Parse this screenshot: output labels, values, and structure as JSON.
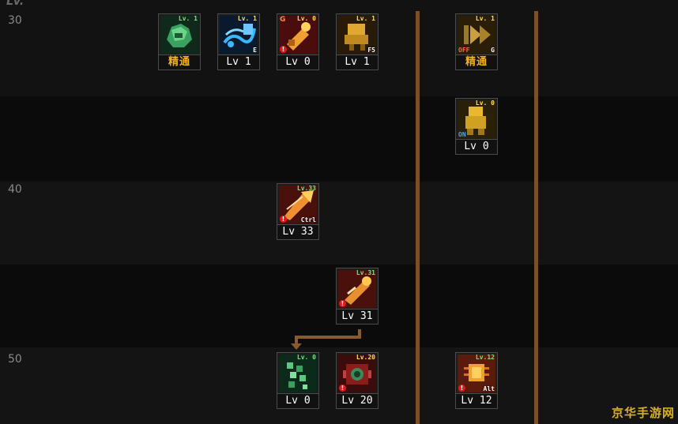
{
  "header": {
    "lv_header": "Lv."
  },
  "rows": [
    {
      "label": "30"
    },
    {
      "label": "40"
    },
    {
      "label": "50"
    }
  ],
  "skills": [
    {
      "id": "s1",
      "level_text": "精通",
      "icon": "green-glove-icon",
      "corner_lv": "Lv. 1",
      "key": "",
      "mastery": true
    },
    {
      "id": "s2",
      "level_text": "Lv 1",
      "icon": "blue-wind-icon",
      "corner_lv": "Lv. 1",
      "key": "E"
    },
    {
      "id": "s3",
      "level_text": "Lv 0",
      "icon": "orange-cannon-icon",
      "corner_lv": "Lv. 0",
      "key": "",
      "g_tag": "G",
      "warning": true
    },
    {
      "id": "s4",
      "level_text": "Lv 1",
      "icon": "gold-mech-icon",
      "corner_lv": "Lv. 1",
      "key": "F5"
    },
    {
      "id": "s5",
      "level_text": "精通",
      "icon": "play-forward-icon",
      "corner_lv": "Lv. 1",
      "key": "G",
      "off_tag": "OFF",
      "mastery": true
    },
    {
      "id": "s6",
      "level_text": "Lv 0",
      "icon": "gold-armor-icon",
      "corner_lv": "Lv. 0",
      "key": "",
      "on_tag": "ON"
    },
    {
      "id": "s7",
      "level_text": "Lv 33",
      "icon": "orange-blast-icon",
      "corner_lv": "Lv.33",
      "key": "Ctrl",
      "warning": true
    },
    {
      "id": "s8",
      "level_text": "Lv 31",
      "icon": "orange-missile-icon",
      "corner_lv": "Lv.31",
      "key": "",
      "warning": true
    },
    {
      "id": "s9",
      "level_text": "Lv 0",
      "icon": "green-swarm-icon",
      "corner_lv": "Lv. 0",
      "key": ""
    },
    {
      "id": "s10",
      "level_text": "Lv 20",
      "icon": "red-turret-icon",
      "corner_lv": "Lv.20",
      "key": "",
      "warning": true
    },
    {
      "id": "s11",
      "level_text": "Lv 12",
      "icon": "orange-chip-icon",
      "corner_lv": "Lv.12",
      "key": "Alt",
      "warning": true
    }
  ],
  "watermark": {
    "text": "京华手游网"
  }
}
